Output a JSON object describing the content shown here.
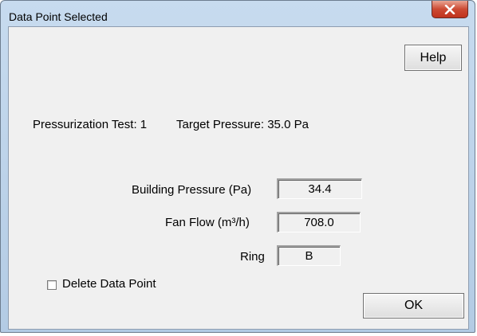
{
  "window": {
    "title": "Data Point Selected",
    "close_icon": "close-x-icon"
  },
  "buttons": {
    "help_label": "Help",
    "ok_label": "OK"
  },
  "test_info": {
    "test_label": "Pressurization Test: 1",
    "target_pressure": "Target Pressure: 35.0 Pa"
  },
  "fields": {
    "building_pressure": {
      "label": "Building Pressure (Pa)",
      "value": "34.4"
    },
    "fan_flow": {
      "label": "Fan Flow (m³/h)",
      "value": "708.0"
    },
    "ring": {
      "label": "Ring",
      "value": "B"
    }
  },
  "options": {
    "delete_label": "Delete Data Point",
    "delete_checked": false
  }
}
